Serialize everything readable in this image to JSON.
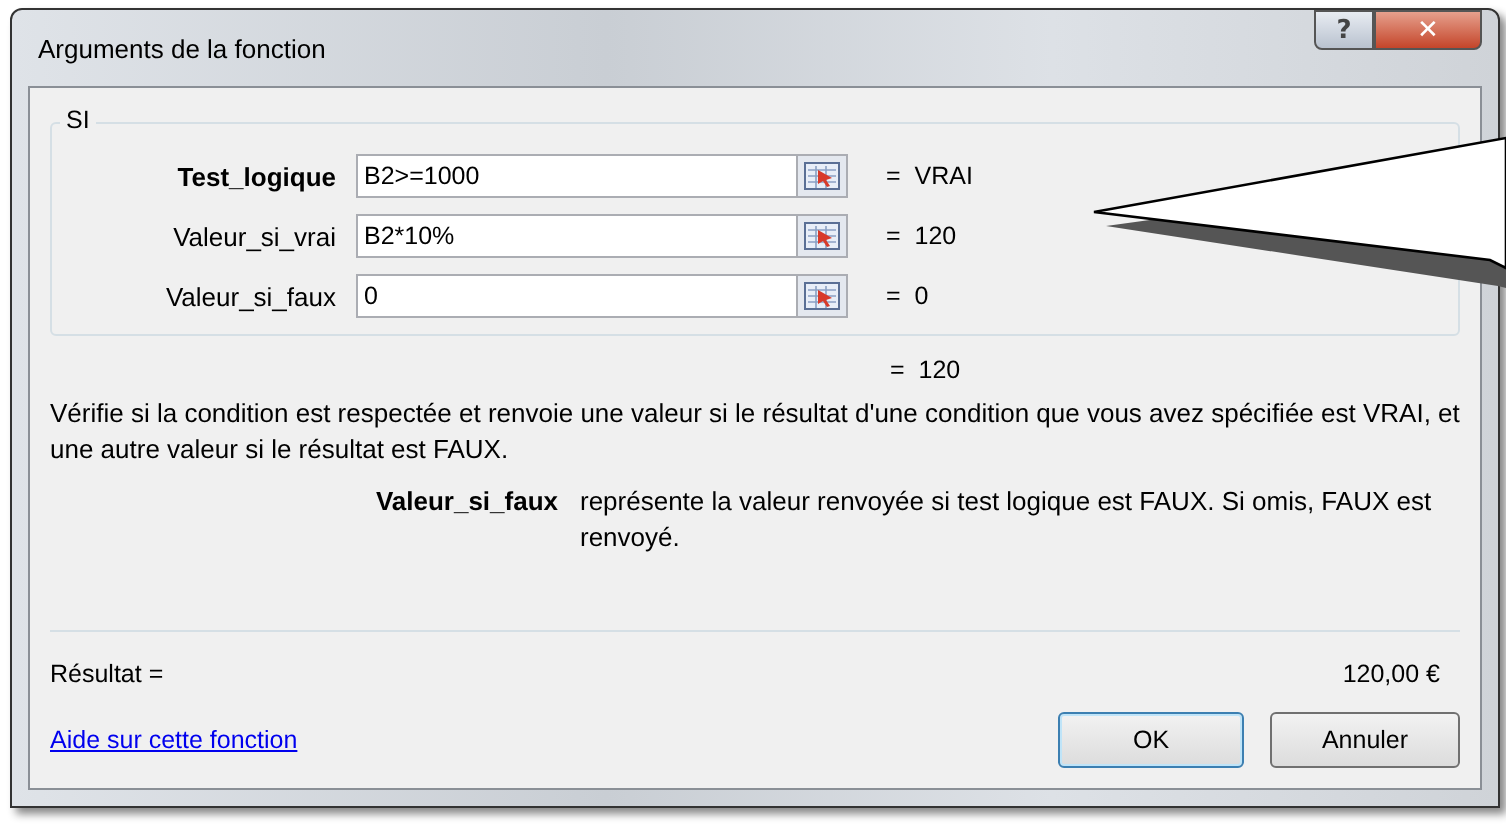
{
  "window": {
    "title": "Arguments de la fonction",
    "buttons": [
      "?",
      "✕"
    ]
  },
  "function_group": {
    "name": "SI",
    "arguments": [
      {
        "label": "Test_logique",
        "required": true,
        "value": "B2>=1000",
        "result": "=  VRAI"
      },
      {
        "label": "Valeur_si_vrai",
        "required": false,
        "value": "B2*10%",
        "result": "=  120"
      },
      {
        "label": "Valeur_si_faux",
        "required": false,
        "value": "0",
        "result": "=  0"
      }
    ]
  },
  "formula_result": "=  120",
  "description": "Vérifie si la condition est respectée et renvoie une valeur si le résultat d'une condition que vous avez spécifiée est VRAI, et une autre valeur si le résultat est FAUX.",
  "argument_help": {
    "label": "Valeur_si_faux",
    "text": "représente la valeur renvoyée si test logique est FAUX. Si omis, FAUX est renvoyé."
  },
  "result": {
    "label": "Résultat =",
    "value": "120,00 €"
  },
  "help_link": "Aide sur cette fonction",
  "buttons": [
    {
      "label": "OK",
      "default": true
    },
    {
      "label": "Annuler",
      "default": false
    }
  ]
}
